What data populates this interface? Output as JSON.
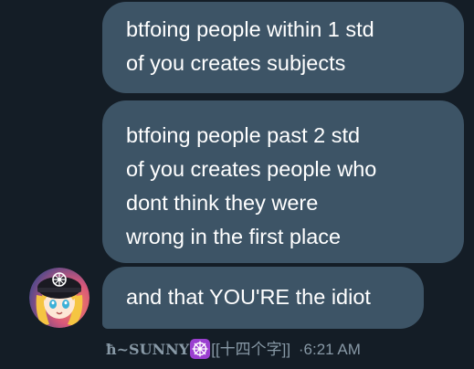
{
  "messages": [
    {
      "lines": [
        "btfoing people within 1 std",
        "of you creates subjects"
      ]
    },
    {
      "lines": [
        "btfoing people past 2 std",
        "of you creates people who",
        "dont think they were",
        "wrong in the first place"
      ]
    },
    {
      "lines": [
        "and that YOU'RE the idiot"
      ]
    }
  ],
  "sender": {
    "name": "ħ~SUNNY",
    "handle_suffix": "[[十四个字]]",
    "badge_icon": "dharma-wheel-emoji-icon",
    "avatar_icon": "anime-avatar-icon"
  },
  "timestamp": {
    "separator": "·",
    "time": "6:21 AM"
  },
  "colors": {
    "background": "#141d26",
    "bubble": "#3d5466",
    "meta_text": "#8899a6",
    "badge": "#9b3fd0"
  }
}
